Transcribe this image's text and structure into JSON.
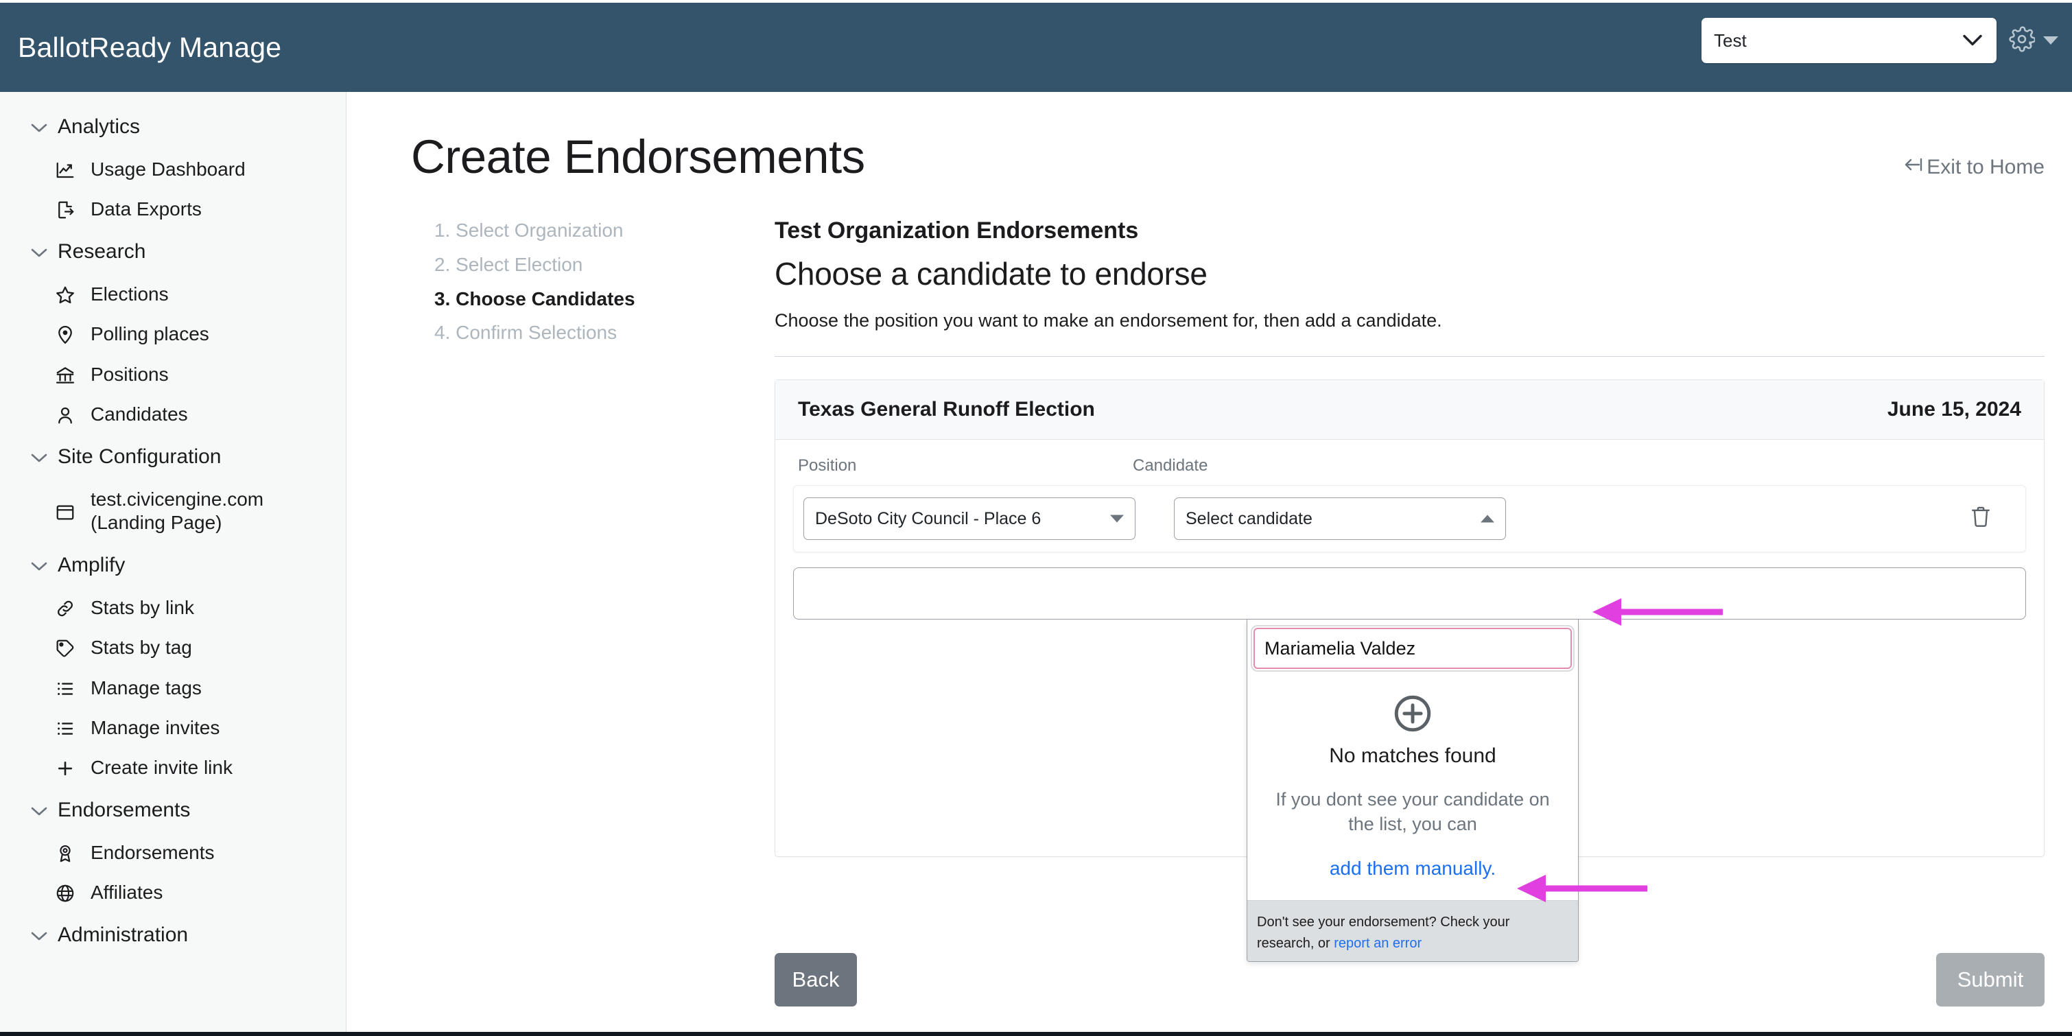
{
  "header": {
    "brand": "BallotReady Manage",
    "org_selector_value": "Test",
    "gear_icon": "gear-icon",
    "chevron_icon": "chevron-down-icon"
  },
  "sidebar": {
    "groups": [
      {
        "label": "Analytics",
        "items": [
          {
            "label": "Usage Dashboard",
            "icon": "chart-line-icon"
          },
          {
            "label": "Data Exports",
            "icon": "file-export-icon"
          }
        ]
      },
      {
        "label": "Research",
        "items": [
          {
            "label": "Elections",
            "icon": "star-icon"
          },
          {
            "label": "Polling places",
            "icon": "map-pin-icon"
          },
          {
            "label": "Positions",
            "icon": "bank-icon"
          },
          {
            "label": "Candidates",
            "icon": "user-icon"
          }
        ]
      },
      {
        "label": "Site Configuration",
        "items": [
          {
            "label": "test.civicengine.com\n(Landing Page)",
            "icon": "browser-window-icon"
          }
        ]
      },
      {
        "label": "Amplify",
        "items": [
          {
            "label": "Stats by link",
            "icon": "link-icon"
          },
          {
            "label": "Stats by tag",
            "icon": "tag-icon"
          },
          {
            "label": "Manage tags",
            "icon": "list-icon"
          },
          {
            "label": "Manage invites",
            "icon": "list-icon"
          },
          {
            "label": "Create invite link",
            "icon": "plus-icon"
          }
        ]
      },
      {
        "label": "Endorsements",
        "items": [
          {
            "label": "Endorsements",
            "icon": "ribbon-award-icon"
          },
          {
            "label": "Affiliates",
            "icon": "globe-icon"
          }
        ]
      },
      {
        "label": "Administration",
        "items": []
      }
    ]
  },
  "main": {
    "page_title": "Create Endorsements",
    "exit_link": "Exit to Home",
    "exit_icon": "arrow-left-to-bar-icon",
    "steps": [
      {
        "label": "1. Select Organization",
        "active": false
      },
      {
        "label": "2. Select Election",
        "active": false
      },
      {
        "label": "3. Choose Candidates",
        "active": true
      },
      {
        "label": "4. Confirm Selections",
        "active": false
      }
    ],
    "org_heading": "Test Organization Endorsements",
    "section_heading": "Choose a candidate to endorse",
    "lede": "Choose the position you want to make an endorsement for, then add a candidate.",
    "card": {
      "election_name": "Texas General Runoff Election",
      "election_date": "June 15, 2024",
      "columns": [
        "Position",
        "Candidate"
      ],
      "rows": [
        {
          "position_value": "DeSoto City Council - Place 6",
          "candidate_value": "Select candidate",
          "delete_icon": "trash-icon"
        }
      ]
    },
    "dropdown": {
      "search_value": "Mariamelia Valdez",
      "plus_icon": "plus-circle-icon",
      "no_matches": "No matches found",
      "hint": "If you dont see your candidate on the list, you can",
      "link": "add them manually.",
      "footer_text": "Don't see your endorsement? Check your research, or ",
      "footer_link": "report an error"
    },
    "buttons": {
      "back": "Back",
      "submit": "Submit"
    }
  },
  "annotations": {
    "arrow_color": "#e040e0",
    "arrows": [
      {
        "name": "arrow-to-candidate-select"
      },
      {
        "name": "arrow-to-add-manually-link"
      }
    ]
  },
  "colors": {
    "header_bg": "#33546b",
    "sidebar_bg": "#f7f8f8",
    "link_blue": "#1d6ff2",
    "pink_focus": "#e48cb0",
    "muted": "#6c757d"
  }
}
